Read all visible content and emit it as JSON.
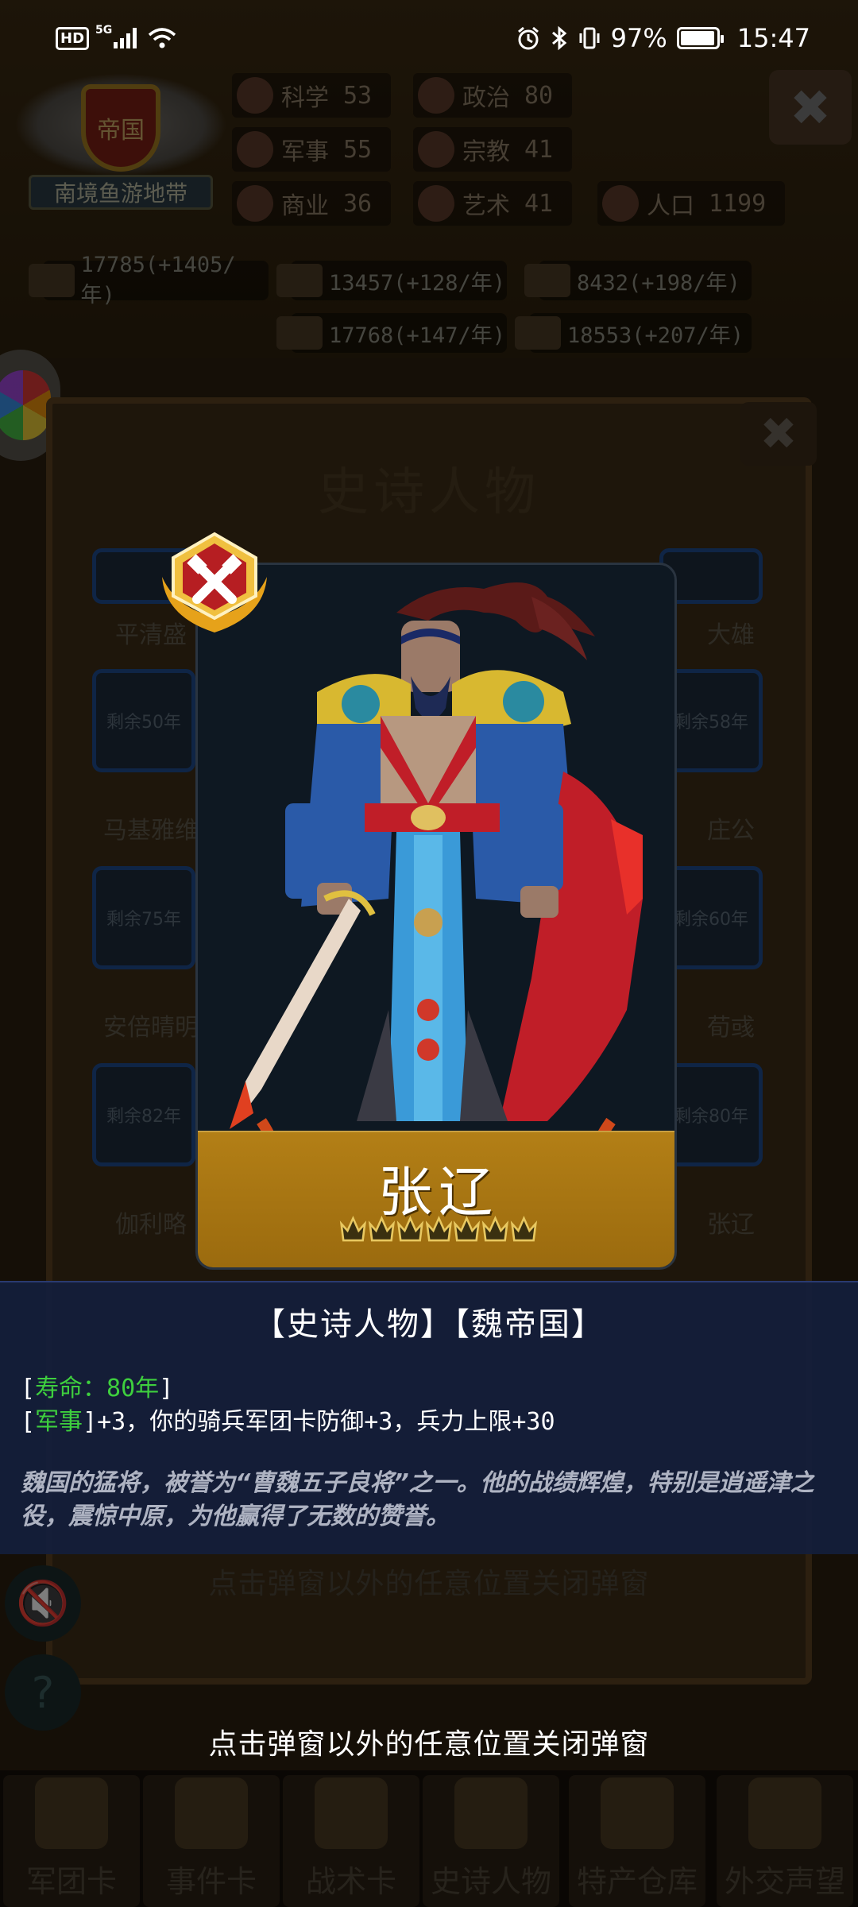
{
  "status_bar": {
    "hd": "HD",
    "network": "5G",
    "battery_pct": "97%",
    "time": "15:47",
    "battery_level": 0.97
  },
  "nation": {
    "title": "帝国",
    "region": "南境鱼游地带"
  },
  "stats": [
    {
      "label": "科学",
      "value": "53",
      "icon": "planet-icon"
    },
    {
      "label": "政治",
      "value": "80",
      "icon": "capitol-icon"
    },
    {
      "label": "军事",
      "value": "55",
      "icon": "crossed-swords-icon"
    },
    {
      "label": "宗教",
      "value": "41",
      "icon": "cross-icon"
    },
    {
      "label": "商业",
      "value": "36",
      "icon": "scales-icon"
    },
    {
      "label": "艺术",
      "value": "41",
      "icon": "lotus-icon"
    },
    {
      "label": "人口",
      "value": "1199",
      "icon": "person-icon"
    }
  ],
  "resources": [
    {
      "text": "17785(+1405/年)",
      "icon": "gold-coins-icon"
    },
    {
      "text": "13457(+128/年)",
      "icon": "wood-icon"
    },
    {
      "text": "8432(+198/年)",
      "icon": "stone-icon"
    },
    {
      "text": "17768(+147/年)",
      "icon": "iron-icon"
    },
    {
      "text": "18553(+207/年)",
      "icon": "meat-icon"
    }
  ],
  "panel": {
    "title": "史诗人物"
  },
  "bg_cards": [
    {
      "name": "平清盛",
      "badge": ""
    },
    {
      "name": "大雄",
      "badge": ""
    },
    {
      "name": "马基雅维",
      "badge": "剩余50年"
    },
    {
      "name": "庄公",
      "badge": "剩余58年"
    },
    {
      "name": "安倍晴明",
      "badge": "剩余75年"
    },
    {
      "name": "荀彧",
      "badge": "剩余60年"
    },
    {
      "name": "伽利略",
      "badge": "剩余82年"
    },
    {
      "name": "张辽",
      "badge": "剩余80年"
    }
  ],
  "character": {
    "name": "张辽",
    "stars": 7,
    "tags": "【史诗人物】【魏帝国】",
    "lifespan_line": {
      "open": "[",
      "label": "寿命：80年",
      "close": "]"
    },
    "military_line": {
      "open": "[",
      "label": "军事",
      "rest": "]+3，你的骑兵军团卡防御+3，兵力上限+30"
    },
    "description": "魏国的猛将，被誉为“曹魏五子良将”之一。他的战绩辉煌，特别是逍遥津之役，震惊中原，为他赢得了无数的赞誉。"
  },
  "hint": "点击弹窗以外的任意位置关闭弹窗",
  "tabs": [
    {
      "label": "军团卡",
      "icon": "helmet-icon"
    },
    {
      "label": "事件卡",
      "icon": "scroll-icon"
    },
    {
      "label": "战术卡",
      "icon": "compass-icon"
    },
    {
      "label": "史诗人物",
      "icon": "crown-icon"
    },
    {
      "label": "特产仓库",
      "icon": "chest-icon"
    },
    {
      "label": "外交声望",
      "icon": "letter-icon"
    }
  ],
  "colors": {
    "gold": "#b37f16",
    "card_bg": "#0e1822",
    "info_panel": "#141e3c",
    "highlight_green": "#3ecf3e"
  }
}
